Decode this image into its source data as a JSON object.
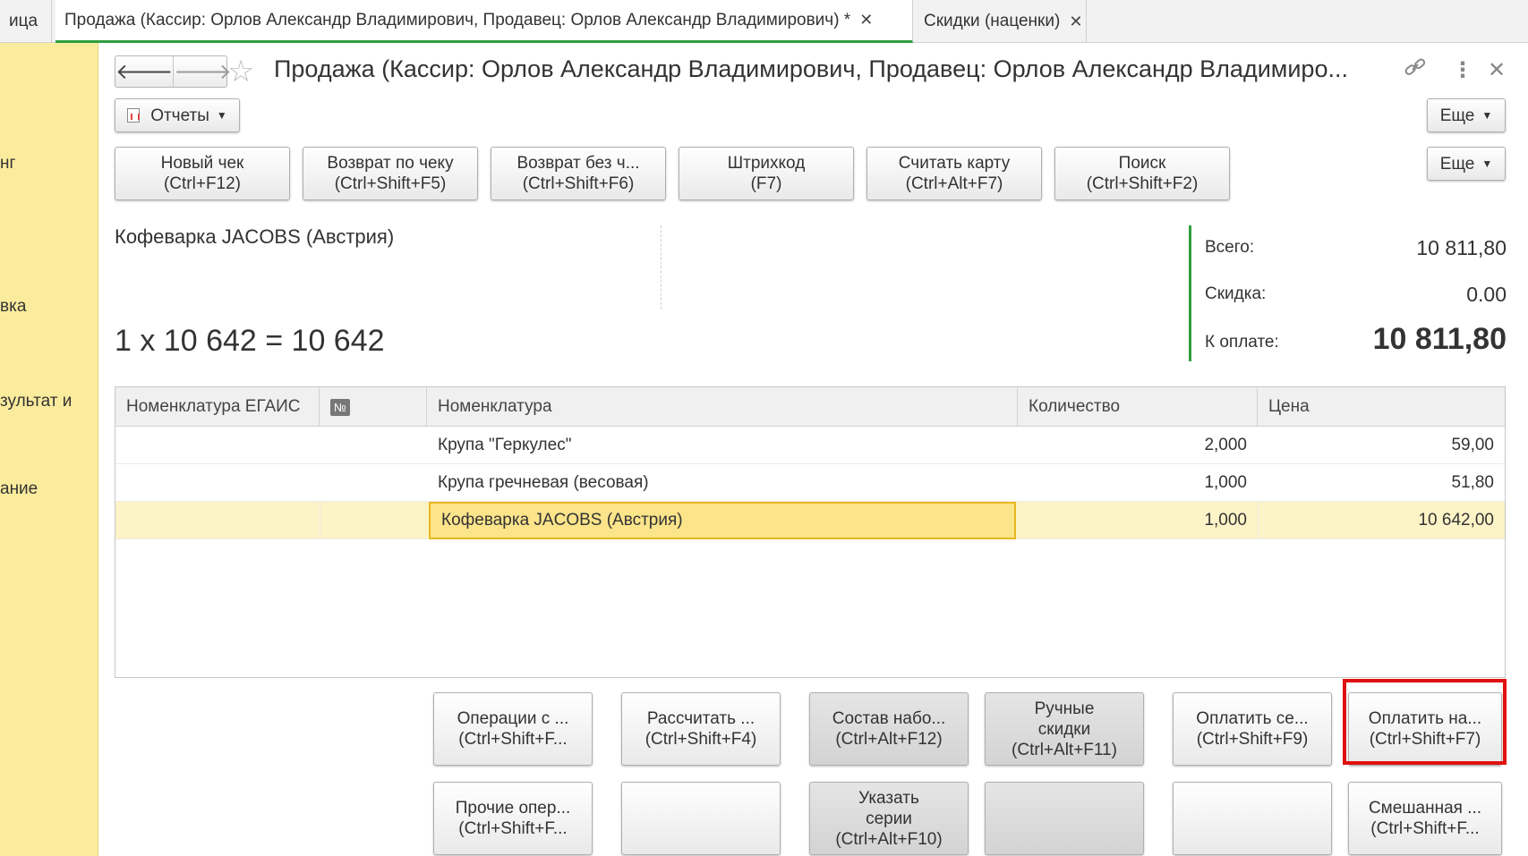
{
  "tabs": [
    {
      "label": "ица",
      "closable": false
    },
    {
      "label": "Продажа (Кассир: Орлов Александр Владимирович, Продавец: Орлов Александр Владимирович) *",
      "closable": true,
      "active": true
    },
    {
      "label": "Скидки (наценки)",
      "closable": true
    }
  ],
  "left_panel": {
    "items": [
      "нг",
      "вка",
      "зультат и",
      "ание"
    ]
  },
  "form": {
    "title": "Продажа (Кассир: Орлов Александр Владимирович, Продавец: Орлов Александр Владимиро...",
    "reports_label": "Отчеты",
    "more_label": "Еще",
    "more_label_2": "Еще"
  },
  "icons": {
    "back": "arrow-left-icon",
    "forward": "arrow-right-icon",
    "favorite": "star-icon",
    "link": "link-icon",
    "menu": "kebab-menu-icon",
    "close": "close-icon",
    "reports": "report-icon"
  },
  "top_buttons": [
    {
      "line1": "Новый чек",
      "line2": "(Ctrl+F12)"
    },
    {
      "line1": "Возврат по чеку",
      "line2": "(Ctrl+Shift+F5)"
    },
    {
      "line1": "Возврат без ч...",
      "line2": "(Ctrl+Shift+F6)"
    },
    {
      "line1": "Штрихкод",
      "line2": "(F7)"
    },
    {
      "line1": "Считать карту",
      "line2": "(Ctrl+Alt+F7)"
    },
    {
      "line1": "Поиск",
      "line2": "(Ctrl+Shift+F2)"
    }
  ],
  "product": {
    "name": "Кофеварка JACOBS (Австрия)",
    "calc": "1 x 10 642 = 10 642"
  },
  "totals": {
    "total_label": "Всего:",
    "total_value": "10 811,80",
    "discount_label": "Скидка:",
    "discount_value": "0.00",
    "pay_label": "К оплате:",
    "pay_value": "10 811,80"
  },
  "table": {
    "headers": [
      "Номенклатура ЕГАИС",
      "№",
      "Номенклатура",
      "Количество",
      "Цена"
    ],
    "rows": [
      {
        "egais": "",
        "num": "",
        "item": "Крупа \"Геркулес\"",
        "qty": "2,000",
        "price": "59,00"
      },
      {
        "egais": "",
        "num": "",
        "item": "Крупа гречневая (весовая)",
        "qty": "1,000",
        "price": "51,80"
      },
      {
        "egais": "",
        "num": "",
        "item": "Кофеварка JACOBS (Австрия)",
        "qty": "1,000",
        "price": "10 642,00",
        "selected": true
      }
    ]
  },
  "bottom_buttons": {
    "row1": [
      {
        "lines": [
          "Операции с ...",
          "(Ctrl+Shift+F..."
        ]
      },
      {
        "lines": [
          "Рассчитать ...",
          "(Ctrl+Shift+F4)"
        ]
      },
      {
        "lines": [
          "Состав набо...",
          "(Ctrl+Alt+F12)"
        ]
      },
      {
        "lines": [
          "Ручные",
          "скидки",
          "(Ctrl+Alt+F11)"
        ]
      },
      {
        "lines": [
          "Оплатить се...",
          "(Ctrl+Shift+F9)"
        ]
      },
      {
        "lines": [
          "Оплатить на...",
          "(Ctrl+Shift+F7)"
        ]
      }
    ],
    "row2": [
      {
        "lines": [
          "Прочие опер...",
          "(Ctrl+Shift+F..."
        ]
      },
      {
        "lines": []
      },
      {
        "lines": [
          "Указать",
          "серии",
          "(Ctrl+Alt+F10)"
        ]
      },
      {
        "lines": []
      },
      {
        "lines": []
      },
      {
        "lines": [
          "Смешанная ...",
          "(Ctrl+Shift+F..."
        ]
      }
    ]
  },
  "colors": {
    "accent_green": "#2f9e3e",
    "left_panel": "#fbec9d",
    "selected_row": "#fcf3c7",
    "current_cell": "#fbe48a",
    "highlight_box": "#e01010"
  }
}
